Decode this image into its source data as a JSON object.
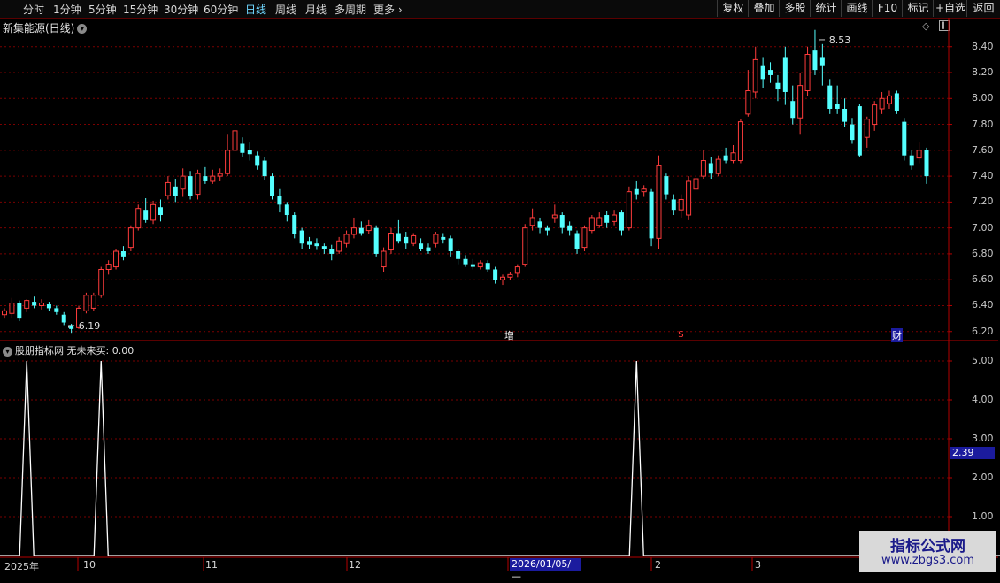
{
  "toolbar": {
    "periods": [
      {
        "label": "分时",
        "active": false
      },
      {
        "label": "1分钟",
        "active": false
      },
      {
        "label": "5分钟",
        "active": false
      },
      {
        "label": "15分钟",
        "active": false
      },
      {
        "label": "30分钟",
        "active": false
      },
      {
        "label": "60分钟",
        "active": false
      },
      {
        "label": "日线",
        "active": true
      },
      {
        "label": "周线",
        "active": false
      },
      {
        "label": "月线",
        "active": false
      },
      {
        "label": "多周期",
        "active": false
      },
      {
        "label": "更多",
        "active": false
      }
    ],
    "right_buttons": [
      "复权",
      "叠加",
      "多股",
      "统计",
      "画线",
      "F10",
      "标记",
      "+自选",
      "返回"
    ]
  },
  "chart": {
    "title": "新集能源(日线)",
    "high_label": "8.53",
    "low_label": "6.19",
    "price_ticks": [
      "8.40",
      "8.20",
      "8.00",
      "7.80",
      "7.60",
      "7.40",
      "7.20",
      "7.00",
      "6.80",
      "6.60",
      "6.40",
      "6.20"
    ],
    "event_tags": [
      {
        "text": "增",
        "color": "#ffffff"
      },
      {
        "text": "$",
        "color": "#ff3a3a"
      },
      {
        "text": "财",
        "color": "#ffffff"
      }
    ]
  },
  "indicator": {
    "title": "股朋指标网",
    "value_label": "无未来买: 0.00",
    "ticks": [
      "5.00",
      "4.00",
      "3.00",
      "2.00",
      "1.00"
    ],
    "current_value": "2.39"
  },
  "xaxis": {
    "labels": [
      "2025年",
      "10",
      "11",
      "12",
      "2",
      "3"
    ],
    "cursor_date": "2026/01/05/—"
  },
  "watermark": {
    "line1": "指标公式网",
    "line2": "www.zbgs3.com"
  },
  "colors": {
    "up": "#ff3c3c",
    "down": "#54ffff",
    "grid": "#7a0000",
    "border": "#b40000",
    "signal": "#ffffff"
  },
  "chart_data": {
    "type": "candlestick",
    "ylim": [
      6.13,
      8.61
    ],
    "price_ticks": [
      8.4,
      8.2,
      8.0,
      7.8,
      7.6,
      7.4,
      7.2,
      7.0,
      6.8,
      6.6,
      6.4,
      6.2
    ],
    "candles": [
      [
        6.33,
        6.36,
        6.3,
        6.38
      ],
      [
        6.34,
        6.42,
        6.3,
        6.46
      ],
      [
        6.42,
        6.3,
        6.28,
        6.44
      ],
      [
        6.38,
        6.44,
        6.35,
        6.45
      ],
      [
        6.43,
        6.4,
        6.38,
        6.47
      ],
      [
        6.4,
        6.42,
        6.37,
        6.45
      ],
      [
        6.41,
        6.38,
        6.36,
        6.43
      ],
      [
        6.38,
        6.35,
        6.33,
        6.4
      ],
      [
        6.33,
        6.27,
        6.25,
        6.35
      ],
      [
        6.25,
        6.22,
        6.19,
        6.26
      ],
      [
        6.23,
        6.38,
        6.22,
        6.4
      ],
      [
        6.36,
        6.48,
        6.34,
        6.5
      ],
      [
        6.38,
        6.48,
        6.36,
        6.5
      ],
      [
        6.48,
        6.68,
        6.46,
        6.7
      ],
      [
        6.68,
        6.72,
        6.64,
        6.75
      ],
      [
        6.7,
        6.82,
        6.68,
        6.84
      ],
      [
        6.82,
        6.78,
        6.75,
        6.86
      ],
      [
        6.85,
        7.0,
        6.82,
        7.02
      ],
      [
        7.0,
        7.15,
        6.98,
        7.18
      ],
      [
        7.14,
        7.06,
        7.04,
        7.23
      ],
      [
        7.06,
        7.18,
        7.03,
        7.21
      ],
      [
        7.16,
        7.1,
        7.05,
        7.22
      ],
      [
        7.25,
        7.35,
        7.22,
        7.4
      ],
      [
        7.32,
        7.25,
        7.2,
        7.38
      ],
      [
        7.3,
        7.4,
        7.24,
        7.46
      ],
      [
        7.4,
        7.25,
        7.22,
        7.44
      ],
      [
        7.26,
        7.42,
        7.22,
        7.45
      ],
      [
        7.4,
        7.36,
        7.34,
        7.47
      ],
      [
        7.36,
        7.4,
        7.34,
        7.45
      ],
      [
        7.4,
        7.42,
        7.36,
        7.46
      ],
      [
        7.42,
        7.6,
        7.4,
        7.72
      ],
      [
        7.6,
        7.75,
        7.56,
        7.8
      ],
      [
        7.65,
        7.58,
        7.55,
        7.7
      ],
      [
        7.6,
        7.57,
        7.52,
        7.66
      ],
      [
        7.56,
        7.48,
        7.45,
        7.59
      ],
      [
        7.52,
        7.4,
        7.37,
        7.55
      ],
      [
        7.4,
        7.25,
        7.22,
        7.42
      ],
      [
        7.25,
        7.18,
        7.12,
        7.3
      ],
      [
        7.18,
        7.1,
        7.05,
        7.2
      ],
      [
        7.1,
        6.95,
        6.92,
        7.12
      ],
      [
        6.98,
        6.88,
        6.84,
        7.0
      ],
      [
        6.9,
        6.87,
        6.84,
        6.93
      ],
      [
        6.88,
        6.86,
        6.83,
        6.92
      ],
      [
        6.86,
        6.84,
        6.8,
        6.88
      ],
      [
        6.84,
        6.8,
        6.75,
        6.87
      ],
      [
        6.82,
        6.9,
        6.8,
        6.93
      ],
      [
        6.88,
        6.95,
        6.85,
        6.98
      ],
      [
        6.95,
        7.0,
        6.92,
        7.08
      ],
      [
        7.0,
        6.96,
        6.94,
        7.05
      ],
      [
        6.98,
        7.02,
        6.95,
        7.06
      ],
      [
        7.0,
        6.8,
        6.78,
        7.02
      ],
      [
        6.7,
        6.82,
        6.66,
        6.85
      ],
      [
        6.83,
        6.96,
        6.8,
        7.0
      ],
      [
        6.96,
        6.9,
        6.88,
        7.06
      ],
      [
        6.93,
        6.88,
        6.84,
        6.97
      ],
      [
        6.88,
        6.94,
        6.86,
        6.96
      ],
      [
        6.88,
        6.84,
        6.82,
        6.92
      ],
      [
        6.85,
        6.82,
        6.8,
        6.88
      ],
      [
        6.88,
        6.95,
        6.85,
        6.97
      ],
      [
        6.93,
        6.91,
        6.88,
        6.96
      ],
      [
        6.92,
        6.82,
        6.78,
        6.94
      ],
      [
        6.82,
        6.76,
        6.72,
        6.84
      ],
      [
        6.76,
        6.72,
        6.7,
        6.79
      ],
      [
        6.72,
        6.7,
        6.68,
        6.76
      ],
      [
        6.7,
        6.73,
        6.68,
        6.75
      ],
      [
        6.73,
        6.68,
        6.66,
        6.75
      ],
      [
        6.68,
        6.6,
        6.57,
        6.7
      ],
      [
        6.6,
        6.62,
        6.56,
        6.64
      ],
      [
        6.62,
        6.64,
        6.6,
        6.66
      ],
      [
        6.65,
        6.7,
        6.62,
        6.72
      ],
      [
        6.72,
        7.0,
        6.7,
        7.03
      ],
      [
        7.02,
        7.08,
        6.98,
        7.15
      ],
      [
        7.05,
        7.0,
        6.96,
        7.08
      ],
      [
        7.0,
        6.98,
        6.94,
        7.02
      ],
      [
        7.08,
        7.1,
        7.04,
        7.18
      ],
      [
        7.1,
        7.0,
        6.96,
        7.12
      ],
      [
        7.02,
        6.98,
        6.94,
        7.05
      ],
      [
        6.96,
        6.84,
        6.8,
        6.98
      ],
      [
        6.85,
        7.0,
        6.82,
        7.02
      ],
      [
        6.98,
        7.08,
        6.96,
        7.1
      ],
      [
        7.02,
        7.08,
        7.0,
        7.12
      ],
      [
        7.1,
        7.04,
        7.0,
        7.13
      ],
      [
        7.05,
        7.1,
        7.02,
        7.14
      ],
      [
        7.12,
        6.98,
        6.94,
        7.14
      ],
      [
        7.0,
        7.28,
        6.98,
        7.32
      ],
      [
        7.3,
        7.26,
        7.22,
        7.36
      ],
      [
        7.28,
        7.3,
        7.24,
        7.33
      ],
      [
        7.28,
        6.92,
        6.86,
        7.3
      ],
      [
        6.92,
        7.48,
        6.84,
        7.56
      ],
      [
        7.4,
        7.26,
        7.22,
        7.42
      ],
      [
        7.22,
        7.14,
        7.1,
        7.26
      ],
      [
        7.14,
        7.22,
        7.08,
        7.26
      ],
      [
        7.1,
        7.36,
        7.06,
        7.4
      ],
      [
        7.3,
        7.38,
        7.28,
        7.46
      ],
      [
        7.4,
        7.52,
        7.38,
        7.6
      ],
      [
        7.5,
        7.42,
        7.38,
        7.55
      ],
      [
        7.42,
        7.53,
        7.4,
        7.56
      ],
      [
        7.56,
        7.52,
        7.5,
        7.62
      ],
      [
        7.52,
        7.58,
        7.5,
        7.64
      ],
      [
        7.52,
        7.82,
        7.5,
        7.84
      ],
      [
        7.88,
        8.06,
        7.86,
        8.22
      ],
      [
        8.05,
        8.3,
        8.0,
        8.4
      ],
      [
        8.25,
        8.15,
        8.08,
        8.32
      ],
      [
        8.22,
        8.18,
        8.12,
        8.28
      ],
      [
        8.12,
        8.07,
        7.98,
        8.18
      ],
      [
        8.32,
        8.05,
        7.95,
        8.4
      ],
      [
        7.98,
        7.85,
        7.8,
        8.1
      ],
      [
        7.85,
        8.1,
        7.72,
        8.2
      ],
      [
        8.06,
        8.34,
        8.02,
        8.4
      ],
      [
        8.37,
        8.22,
        8.18,
        8.53
      ],
      [
        8.32,
        8.25,
        8.1,
        8.42
      ],
      [
        8.1,
        7.92,
        7.88,
        8.15
      ],
      [
        7.96,
        7.92,
        7.88,
        8.1
      ],
      [
        7.92,
        7.82,
        7.78,
        8.0
      ],
      [
        7.8,
        7.68,
        7.65,
        7.85
      ],
      [
        7.94,
        7.56,
        7.55,
        7.96
      ],
      [
        7.7,
        7.84,
        7.62,
        7.86
      ],
      [
        7.8,
        7.95,
        7.75,
        7.98
      ],
      [
        7.92,
        8.0,
        7.88,
        8.05
      ],
      [
        7.96,
        8.02,
        7.92,
        8.06
      ],
      [
        8.04,
        7.9,
        7.88,
        8.06
      ],
      [
        7.82,
        7.56,
        7.52,
        7.85
      ],
      [
        7.56,
        7.48,
        7.45,
        7.6
      ],
      [
        7.54,
        7.6,
        7.5,
        7.66
      ],
      [
        7.6,
        7.4,
        7.34,
        7.62
      ]
    ],
    "indicator_series": {
      "name": "无未来买",
      "spike_at_candles": [
        3,
        13,
        85,
        143
      ],
      "spike_value": 5.0,
      "ylim": [
        0,
        5.5
      ],
      "ticks": [
        5.0,
        4.0,
        3.0,
        2.0,
        1.0
      ]
    }
  }
}
